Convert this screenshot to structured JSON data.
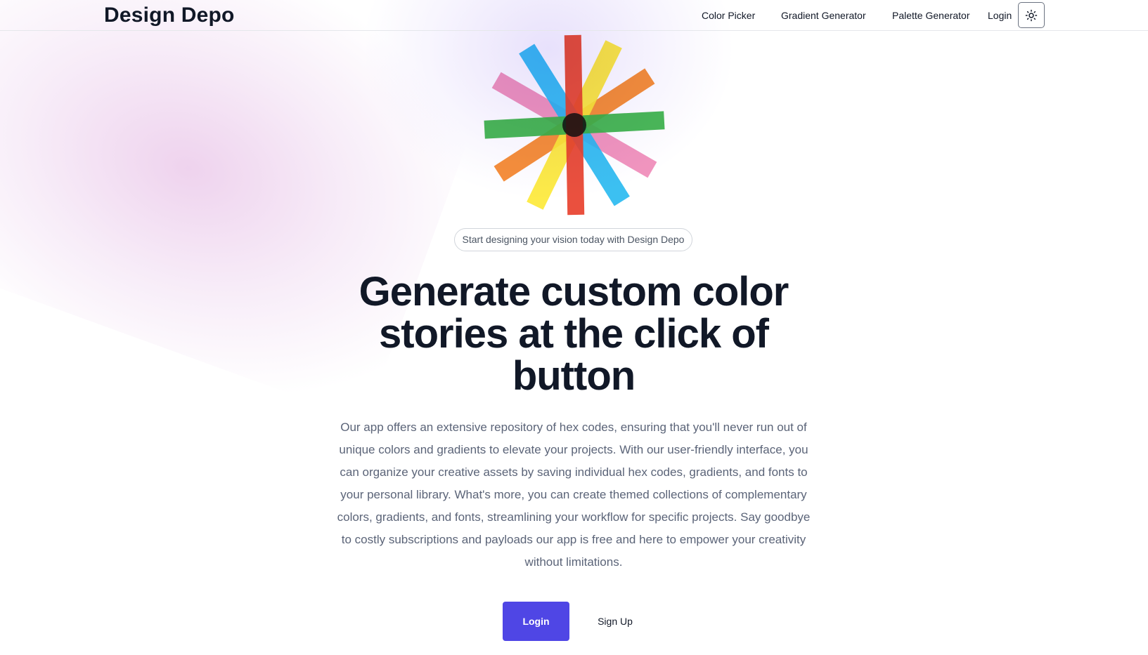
{
  "navbar": {
    "brand": "Design Depo",
    "links": [
      {
        "label": "Color Picker"
      },
      {
        "label": "Gradient Generator"
      },
      {
        "label": "Palette Generator"
      },
      {
        "label": "Login"
      }
    ],
    "theme_toggle_icon": "sun-icon"
  },
  "hero": {
    "logo_icon": "color-starburst-logo",
    "logo_colors": [
      "#e8412e",
      "#fde93a",
      "#f5852b",
      "#3bb34a",
      "#f089b7",
      "#27b9ef"
    ],
    "tagline": "Start designing your vision today with Design Depo",
    "headline": "Generate custom color stories at the click of button",
    "description": "Our app offers an extensive repository of hex codes, ensuring that you'll never run out of unique colors and gradients to elevate your projects. With our user-friendly interface, you can organize your creative assets by saving individual hex codes, gradients, and fonts to your personal library. What's more, you can create themed collections of complementary colors, gradients, and fonts, streamlining your workflow for specific projects. Say goodbye to costly subscriptions and payloads our app is free and here to empower your creativity without limitations.",
    "login_button": "Login",
    "signup_button": "Sign Up",
    "accent_color": "#4f46e5"
  }
}
